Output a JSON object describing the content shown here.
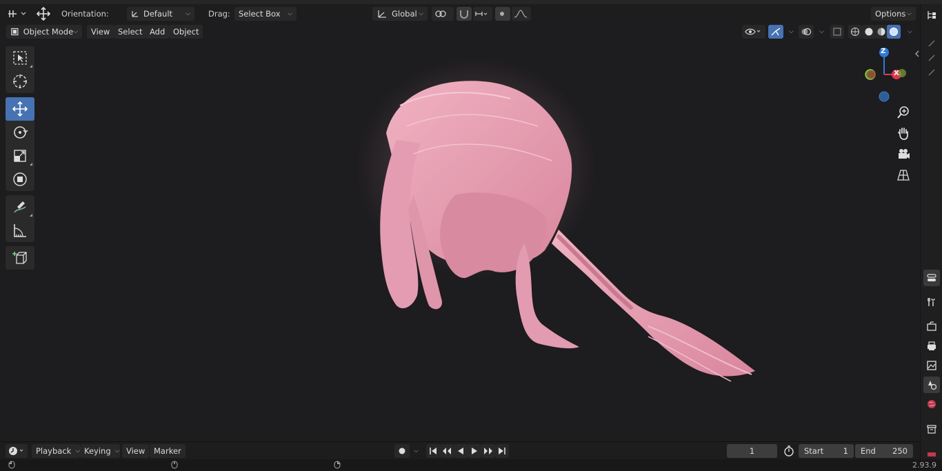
{
  "header": {
    "orientation_label": "Orientation:",
    "orientation_value": "Default",
    "drag_label": "Drag:",
    "drag_value": "Select Box",
    "transform_space": "Global",
    "options_label": "Options"
  },
  "viewport_header": {
    "mode": "Object Mode",
    "menus": [
      "View",
      "Select",
      "Add",
      "Object"
    ]
  },
  "toolbar": {
    "tools": [
      "select-box",
      "cursor",
      "move",
      "rotate",
      "scale",
      "transform",
      "annotate",
      "measure",
      "add-cube"
    ],
    "active_tool": "move"
  },
  "gizmo": {
    "z_label": "Z",
    "x_label": "X"
  },
  "timeline": {
    "menus": [
      "Playback",
      "Keying",
      "View",
      "Marker"
    ],
    "current_frame": "1",
    "start_label": "Start",
    "start_value": "1",
    "end_label": "End",
    "end_value": "250"
  },
  "status": {
    "version": "2.93.9"
  },
  "colors": {
    "accent": "#4772b3",
    "hair": "#e79ab0",
    "viewport_bg": "#1d1c1f",
    "axis_x": "#e0364d",
    "axis_y": "#7fa33a",
    "axis_z": "#2f7bd3"
  }
}
